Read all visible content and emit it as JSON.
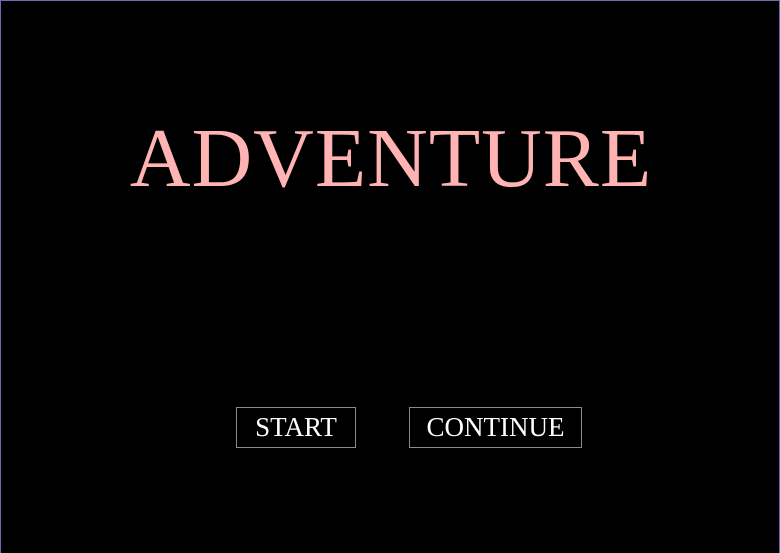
{
  "game": {
    "title": "ADVENTURE",
    "title_color": "#ffb3b3",
    "background_color": "#000000"
  },
  "menu": {
    "start_label": "START",
    "continue_label": "CONTINUE"
  }
}
